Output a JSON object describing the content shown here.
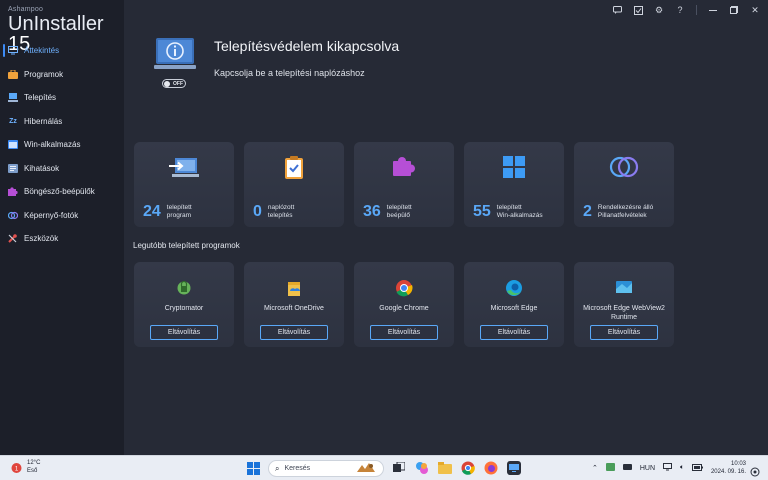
{
  "app": {
    "brand_small": "Ashampoo",
    "brand_name": "UnInstaller",
    "brand_version": "15"
  },
  "sidebar": {
    "items": [
      {
        "label": "Áttekintés",
        "icon": "overview-icon",
        "active": true
      },
      {
        "label": "Programok",
        "icon": "programs-icon"
      },
      {
        "label": "Telepítés",
        "icon": "install-icon"
      },
      {
        "label": "Hibernálás",
        "icon": "sleep-icon"
      },
      {
        "label": "Win-alkalmazás",
        "icon": "windows-app-icon"
      },
      {
        "label": "Kihatások",
        "icon": "impact-icon"
      },
      {
        "label": "Böngésző-beépülők",
        "icon": "puzzle-icon"
      },
      {
        "label": "Képernyő-fotók",
        "icon": "snapshot-icon"
      },
      {
        "label": "Eszközök",
        "icon": "tools-icon"
      }
    ]
  },
  "topbar": [
    "feedback-icon",
    "check-icon",
    "settings-icon",
    "help-icon",
    "minimize-icon",
    "maximize-icon",
    "close-icon"
  ],
  "hero": {
    "title": "Telepítésvédelem kikapcsolva",
    "subtitle": "Kapcsolja be a telepítési naplózáshoz",
    "toggle_label": "OFF"
  },
  "stats": [
    {
      "number": "24",
      "line1": "telepített",
      "line2": "program",
      "icon": "laptop-arrow-icon"
    },
    {
      "number": "0",
      "line1": "naplózott",
      "line2": "telepítés",
      "icon": "clipboard-check-icon"
    },
    {
      "number": "36",
      "line1": "telepített",
      "line2": "beépülő",
      "icon": "puzzle-icon"
    },
    {
      "number": "55",
      "line1": "telepített",
      "line2": "Win-alkalmazás",
      "icon": "windows-logo-icon"
    },
    {
      "number": "2",
      "line1": "Rendelkezésre álló",
      "line2": "Pillanatfelvételek",
      "icon": "snapshot-rings-icon"
    }
  ],
  "recent_title": "Legutóbb telepített programok",
  "programs": [
    {
      "name": "Cryptomator",
      "button": "Eltávolítás",
      "icon": "cryptomator-icon"
    },
    {
      "name": "Microsoft OneDrive",
      "button": "Eltávolítás",
      "icon": "onedrive-icon"
    },
    {
      "name": "Google Chrome",
      "button": "Eltávolítás",
      "icon": "chrome-icon"
    },
    {
      "name": "Microsoft Edge",
      "button": "Eltávolítás",
      "icon": "edge-icon"
    },
    {
      "name": "Microsoft Edge WebView2 Runtime",
      "button": "Eltávolítás",
      "icon": "webview-icon"
    }
  ],
  "taskbar": {
    "weather_temp": "12°C",
    "weather_desc": "Eső",
    "weather_badge": "1",
    "search_placeholder": "Keresés",
    "language": "HUN",
    "time": "10:03",
    "date": "2024. 09. 16."
  }
}
